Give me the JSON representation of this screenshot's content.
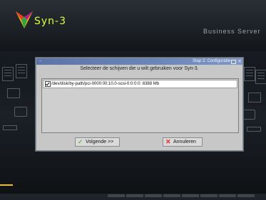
{
  "app": {
    "brand": "Syn-3",
    "edition": "Business Server"
  },
  "dialog": {
    "title": "Stap 2: Configuratie",
    "prompt": "Selecteer de schijven die u wilt gebruiken voor Syn-3.",
    "disks": [
      {
        "checked": true,
        "label": "/dev/disk/by-path/pci-0000:00:10.0-scsi-0:0:0:0: 8388 Mb"
      }
    ],
    "buttons": {
      "next": "Volgende >>",
      "cancel": "Annuleren"
    }
  },
  "colors": {
    "brand": "#d7ff3a",
    "titlebar": "#6c86b8",
    "accent_check": "#38a300",
    "accent_x": "#ee2222"
  },
  "icons": {
    "logo": "syn3-logo-icon",
    "next": "checkmark-icon",
    "cancel": "x-icon"
  }
}
